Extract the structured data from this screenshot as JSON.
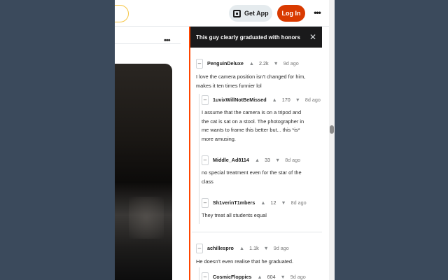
{
  "header": {
    "get_app_label": "Get App",
    "login_label": "Log In",
    "more_glyph": "•••"
  },
  "post": {
    "more_glyph": "•••"
  },
  "comments_panel": {
    "title": "This guy clearly graduated with honors",
    "close_glyph": "✕",
    "comments": [
      {
        "author": "PenguinDeluxe",
        "score": "2.2k",
        "age": "9d ago",
        "text_lines": [
          "I love the camera position isn't changed for him,",
          "makes it ten times funnier lol"
        ]
      },
      {
        "author": "1uvixWillNotBeMissed",
        "score": "170",
        "age": "8d ago",
        "text_lines": [
          "I assume that the camera is on a tripod and",
          "the cat is sat on a stool. The photographer in",
          "me wants to frame this better but... this *is*",
          "more amusing."
        ]
      },
      {
        "author": "Middle_Ad8114",
        "score": "33",
        "age": "8d ago",
        "text_lines": [
          "no special treatment even for the star of the",
          "class"
        ]
      },
      {
        "author": "Sh1verinT1mbers",
        "score": "12",
        "age": "8d ago",
        "text_lines": [
          "They treat all students equal"
        ]
      },
      {
        "author": "achillespro",
        "score": "1.1k",
        "age": "9d ago",
        "text_lines": [
          "He doesn't even realise that he graduated."
        ]
      },
      {
        "author": "CosmicFloppies",
        "score": "604",
        "age": "9d ago",
        "text_lines": []
      }
    ]
  },
  "glyphs": {
    "collapse": "–",
    "upvote": "▲",
    "downvote": "▼"
  }
}
